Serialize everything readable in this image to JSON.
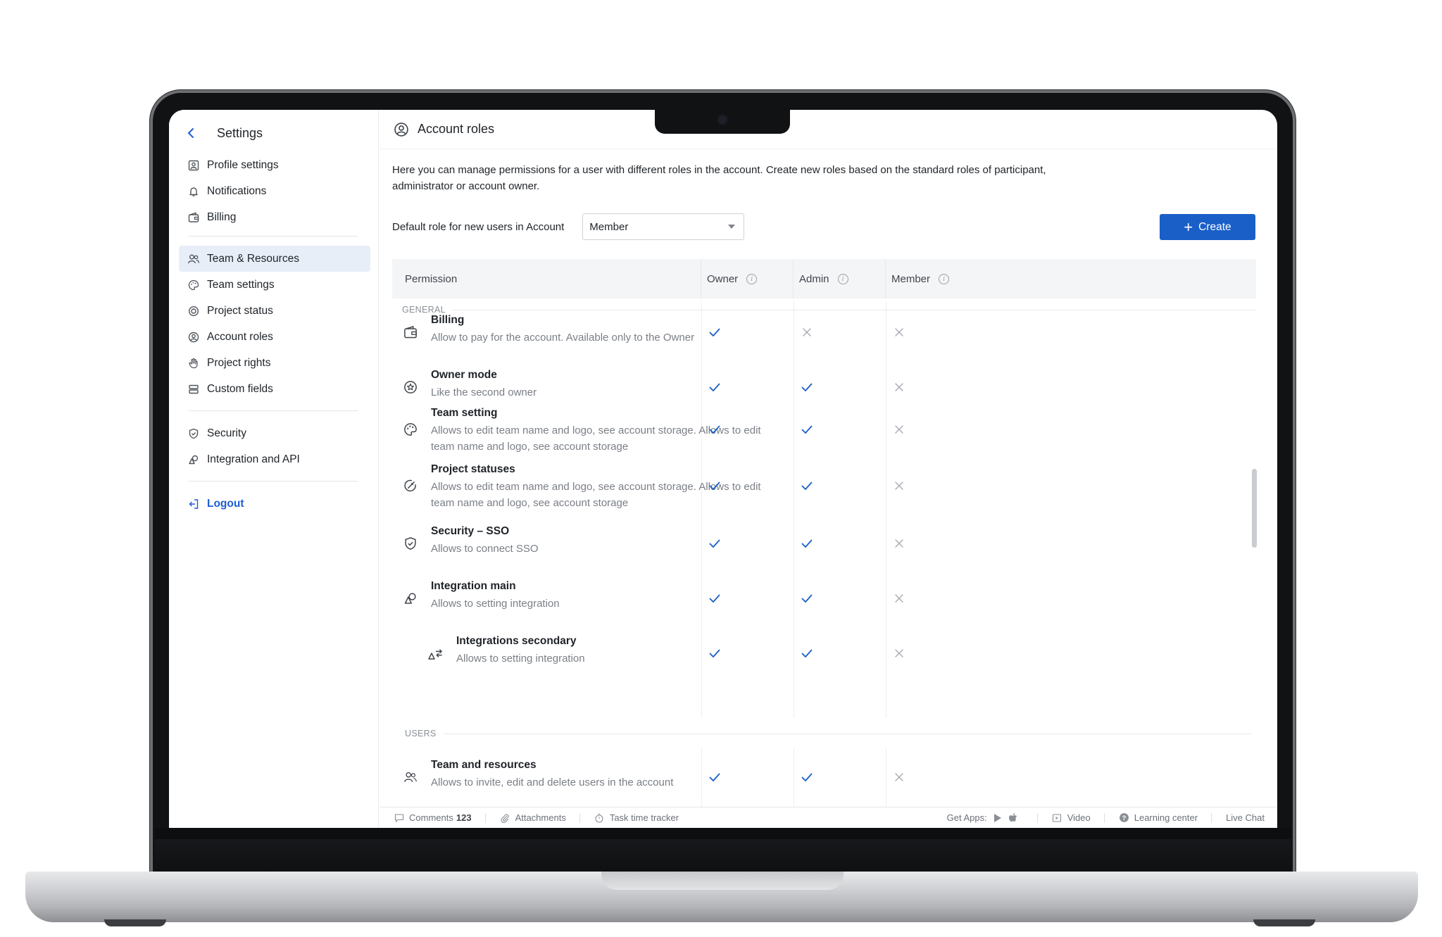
{
  "sidebar": {
    "title": "Settings",
    "group1": [
      "Profile settings",
      "Notifications",
      "Billing"
    ],
    "group2": [
      "Team & Resources",
      "Team settings",
      "Project status",
      "Account roles",
      "Project rights",
      "Custom fields"
    ],
    "group3": [
      "Security",
      "Integration and API"
    ],
    "logout": "Logout",
    "active_item": "Team & Resources"
  },
  "header": {
    "title": "Account roles"
  },
  "description": "Here you can manage permissions for a user with different roles in the account. Create new roles based on the standard roles of participant, administrator or account owner.",
  "default_role": {
    "label": "Default role for new users in Account",
    "value": "Member"
  },
  "create_button": "Create",
  "table": {
    "columns": [
      "Permission",
      "Owner",
      "Admin",
      "Member"
    ],
    "sections": [
      {
        "label": "GENERAL",
        "rows": [
          {
            "icon": "wallet-icon",
            "title": "Billing",
            "desc": "Allow to pay for the account. Available only to the Owner",
            "owner": true,
            "admin": false,
            "member": false
          },
          {
            "icon": "star-circle-icon",
            "title": "Owner mode",
            "desc": "Like the second owner",
            "owner": true,
            "admin": true,
            "member": false
          },
          {
            "icon": "palette-icon",
            "title": "Team setting",
            "desc": "Allows to edit team name and logo, see account storage. Allows to edit team name and logo, see account storage",
            "owner": true,
            "admin": true,
            "member": false
          },
          {
            "icon": "status-icon",
            "title": "Project statuses",
            "desc": "Allows to edit team name and logo, see account storage. Allows to edit team name and logo, see account storage",
            "owner": true,
            "admin": true,
            "member": false
          },
          {
            "icon": "shield-check-icon",
            "title": "Security – SSO",
            "desc": "Allows to connect SSO",
            "owner": true,
            "admin": true,
            "member": false
          },
          {
            "icon": "shapes-icon",
            "title": "Integration main",
            "desc": "Allows to setting integration",
            "owner": true,
            "admin": true,
            "member": false
          },
          {
            "icon": "integration-secondary-icon",
            "title": "Integrations secondary",
            "desc": "Allows to setting integration",
            "owner": true,
            "admin": true,
            "member": false
          }
        ]
      },
      {
        "label": "USERS",
        "rows": [
          {
            "icon": "users-icon",
            "title": "Team and resources",
            "desc": "Allows to invite, edit and delete users in the account",
            "owner": true,
            "admin": true,
            "member": false
          }
        ]
      }
    ]
  },
  "footer": {
    "comments_label": "Comments",
    "comments_count": "123",
    "attachments": "Attachments",
    "tracker": "Task time tracker",
    "get_apps": "Get Apps:",
    "video": "Video",
    "learning": "Learning center",
    "chat": "Live Chat"
  },
  "colors": {
    "accent": "#1a5fc8",
    "active_bg": "#e8eef8"
  }
}
